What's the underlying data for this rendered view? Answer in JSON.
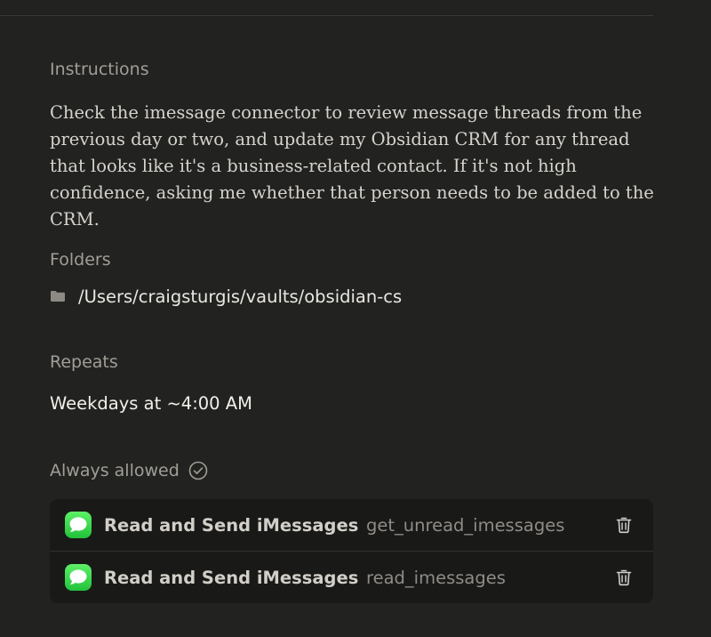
{
  "instructions": {
    "label": "Instructions",
    "text": "Check the imessage connector to review message threads from the previous day or two, and update my Obsidian CRM for any thread that looks like it's a business-related contact. If it's not high confidence, asking me whether that person needs to be added to the CRM."
  },
  "folders": {
    "label": "Folders",
    "icon": "folder-icon",
    "items": [
      {
        "path": "/Users/craigsturgis/vaults/obsidian-cs"
      }
    ]
  },
  "repeats": {
    "label": "Repeats",
    "value": "Weekdays at ~4:00 AM"
  },
  "always_allowed": {
    "label": "Always allowed",
    "icon": "check-circle-icon",
    "items": [
      {
        "app_icon": "imessage-icon",
        "name": "Read and Send iMessages",
        "tool": "get_unread_imessages",
        "action_icon": "trash-icon"
      },
      {
        "app_icon": "imessage-icon",
        "name": "Read and Send iMessages",
        "tool": "read_imessages",
        "action_icon": "trash-icon"
      }
    ]
  },
  "colors": {
    "background": "#222221",
    "card": "#191918",
    "muted_text": "#a19e97",
    "imessage_green": "#34c759"
  }
}
